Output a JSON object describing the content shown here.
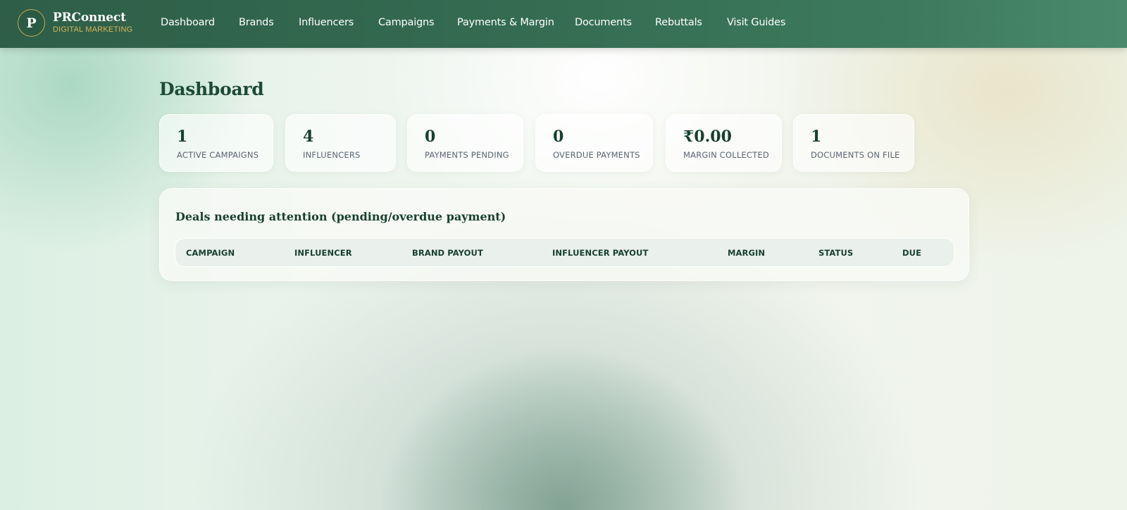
{
  "brand": {
    "badge_letter": "P",
    "name": "PRConnect",
    "tagline": "DIGITAL MARKETING",
    "accent_color": "#c9a94b"
  },
  "nav": {
    "items": [
      {
        "label": "Dashboard"
      },
      {
        "label": "Brands"
      },
      {
        "label": "Influencers"
      },
      {
        "label": "Campaigns"
      },
      {
        "label": "Payments & Margin"
      },
      {
        "label": "Documents"
      },
      {
        "label": "Rebuttals"
      },
      {
        "label": "Visit Guides"
      }
    ]
  },
  "page": {
    "title": "Dashboard"
  },
  "stats": [
    {
      "value": "1",
      "label": "ACTIVE CAMPAIGNS"
    },
    {
      "value": "4",
      "label": "INFLUENCERS"
    },
    {
      "value": "0",
      "label": "PAYMENTS PENDING"
    },
    {
      "value": "0",
      "label": "OVERDUE PAYMENTS"
    },
    {
      "value": "₹0.00",
      "label": "MARGIN COLLECTED"
    },
    {
      "value": "1",
      "label": "DOCUMENTS ON FILE"
    }
  ],
  "attention": {
    "title": "Deals needing attention (pending/overdue payment)",
    "columns": [
      "CAMPAIGN",
      "INFLUENCER",
      "BRAND PAYOUT",
      "INFLUENCER PAYOUT",
      "MARGIN",
      "STATUS",
      "DUE"
    ],
    "rows": []
  },
  "colors": {
    "header_green": "#346b51",
    "heading_text": "#1e4a38",
    "label_text": "#5b6472"
  }
}
